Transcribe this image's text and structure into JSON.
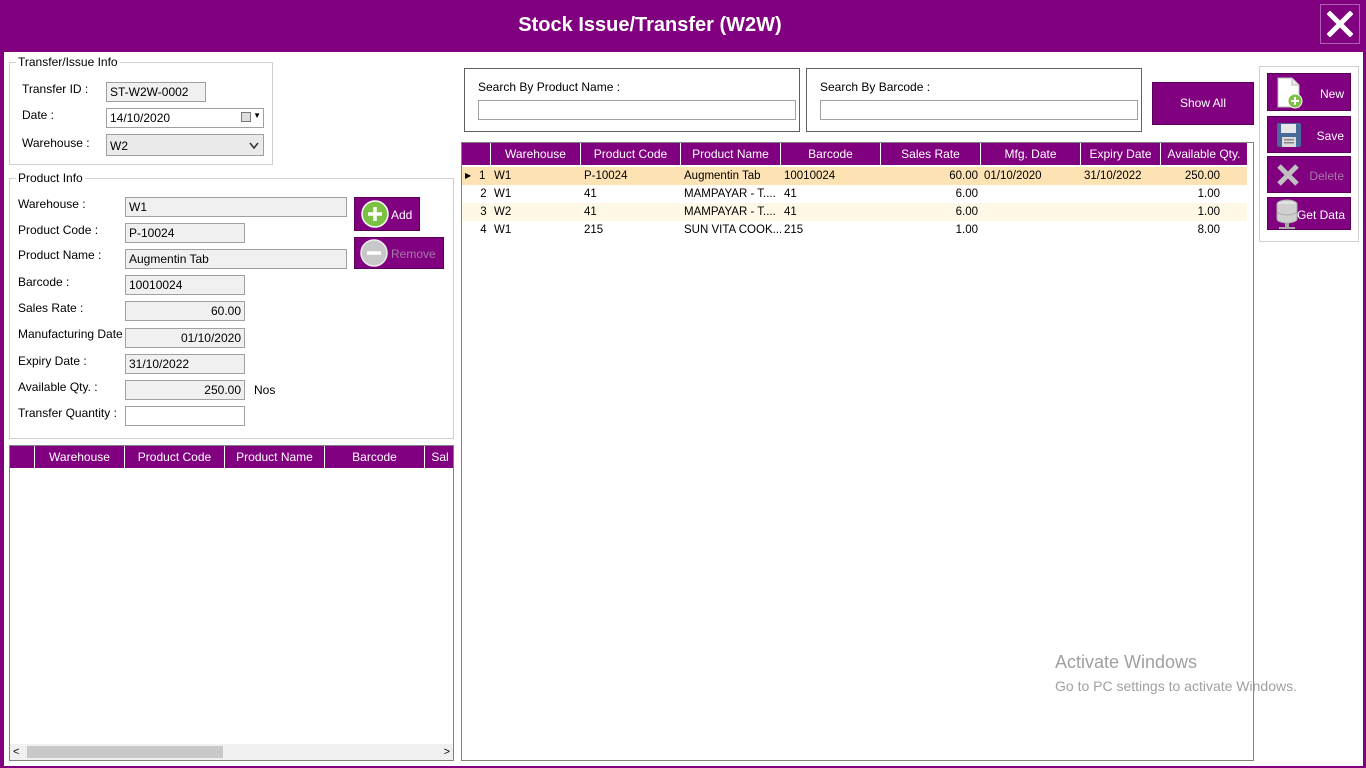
{
  "window": {
    "title": "Stock Issue/Transfer (W2W)",
    "close_icon": "close-icon"
  },
  "transfer_info": {
    "legend": "Transfer/Issue Info",
    "transfer_id_label": "Transfer ID :",
    "transfer_id": "ST-W2W-0002",
    "date_label": "Date :",
    "date": "14/10/2020",
    "warehouse_label": "Warehouse :",
    "warehouse": "W2"
  },
  "product_info": {
    "legend": "Product Info",
    "warehouse_label": "Warehouse :",
    "warehouse": "W1",
    "product_code_label": "Product Code :",
    "product_code": "P-10024",
    "product_name_label": "Product Name :",
    "product_name": "Augmentin Tab",
    "barcode_label": "Barcode :",
    "barcode": "10010024",
    "sales_rate_label": "Sales Rate :",
    "sales_rate": "60.00",
    "mfg_date_label": "Manufacturing Date :",
    "mfg_date": "01/10/2020",
    "expiry_date_label": "Expiry Date :",
    "expiry_date": "31/10/2022",
    "available_qty_label": "Available Qty. :",
    "available_qty": "250.00",
    "unit": "Nos",
    "transfer_qty_label": "Transfer Quantity :",
    "transfer_qty": "",
    "add_label": "Add",
    "remove_label": "Remove"
  },
  "transfer_grid": {
    "columns": [
      "Warehouse",
      "Product Code",
      "Product Name",
      "Barcode",
      "Sal"
    ]
  },
  "search": {
    "product_name_label": "Search By Product Name :",
    "product_name_value": "",
    "barcode_label": "Search By Barcode :",
    "barcode_value": "",
    "show_all_label": "Show All"
  },
  "stock_grid": {
    "columns": [
      "Warehouse",
      "Product Code",
      "Product Name",
      "Barcode",
      "Sales Rate",
      "Mfg. Date",
      "Expiry Date",
      "Available Qty."
    ],
    "rows": [
      {
        "n": "1",
        "warehouse": "W1",
        "code": "P-10024",
        "name": "Augmentin Tab",
        "barcode": "10010024",
        "rate": "60.00",
        "mfg": "01/10/2020",
        "expiry": "31/10/2022",
        "qty": "250.00"
      },
      {
        "n": "2",
        "warehouse": "W1",
        "code": "41",
        "name": "MAMPAYAR - T....",
        "barcode": "41",
        "rate": "6.00",
        "mfg": "",
        "expiry": "",
        "qty": "1.00"
      },
      {
        "n": "3",
        "warehouse": "W2",
        "code": "41",
        "name": "MAMPAYAR - T....",
        "barcode": "41",
        "rate": "6.00",
        "mfg": "",
        "expiry": "",
        "qty": "1.00"
      },
      {
        "n": "4",
        "warehouse": "W1",
        "code": "215",
        "name": "SUN VITA COOK...",
        "barcode": "215",
        "rate": "1.00",
        "mfg": "",
        "expiry": "",
        "qty": "8.00"
      }
    ]
  },
  "actions": {
    "new": "New",
    "save": "Save",
    "delete": "Delete",
    "get_data": "Get Data"
  },
  "watermark": {
    "line1": "Activate Windows",
    "line2": "Go to PC settings to activate Windows."
  },
  "colors": {
    "brand": "#800080",
    "selected_row": "#fde2b4",
    "row_alt": "#fff8e6"
  }
}
